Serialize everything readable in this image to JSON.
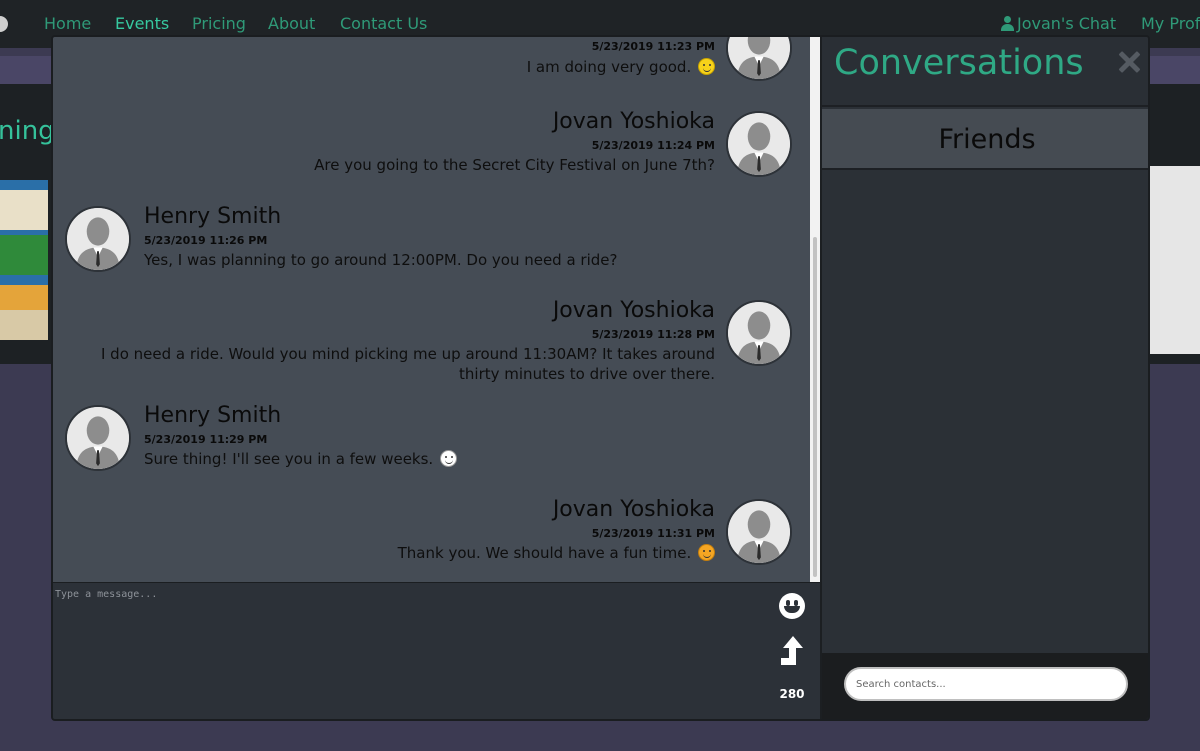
{
  "nav": {
    "items": [
      {
        "label": "Home",
        "active": false
      },
      {
        "label": "Events",
        "active": true
      },
      {
        "label": "Pricing",
        "active": false
      },
      {
        "label": "About",
        "active": false
      },
      {
        "label": "Contact Us",
        "active": false
      }
    ],
    "chat_link": "Jovan's Chat",
    "profile_link": "My Prof"
  },
  "hero": {
    "title_fragment": "ning"
  },
  "chat": {
    "messages": [
      {
        "sender": "",
        "timestamp": "5/23/2019 11:23 PM",
        "text": "I am doing very good.",
        "emoji": "slightly-smiling-face",
        "side": "right"
      },
      {
        "sender": "Jovan Yoshioka",
        "timestamp": "5/23/2019 11:24 PM",
        "text": "Are you going to the Secret City Festival on June 7th?",
        "side": "right"
      },
      {
        "sender": "Henry Smith",
        "timestamp": "5/23/2019 11:26 PM",
        "text": "Yes, I was planning to go around 12:00PM. Do you need a ride?",
        "side": "left"
      },
      {
        "sender": "Jovan Yoshioka",
        "timestamp": "5/23/2019 11:28 PM",
        "text_line1": "I do need a ride. Would you mind picking me up around 11:30AM? It takes around",
        "text_line2": "thirty minutes to drive over there.",
        "side": "right"
      },
      {
        "sender": "Henry Smith",
        "timestamp": "5/23/2019 11:29 PM",
        "text": "Sure thing! I'll see you in a few weeks.",
        "emoji": "smiling-face",
        "side": "left"
      },
      {
        "sender": "Jovan Yoshioka",
        "timestamp": "5/23/2019 11:31 PM",
        "text": "Thank you. We should have a fun time.",
        "emoji": "smiling-face-with-smiling-eyes",
        "side": "right"
      }
    ],
    "input_placeholder": "Type a message...",
    "char_count": "280",
    "icons": {
      "emoji_button": "smiley-icon",
      "send_button": "send-arrow-icon",
      "avatar": "user-silhouette-icon"
    }
  },
  "sidebar": {
    "title": "Conversations",
    "tab_label": "Friends",
    "search_placeholder": "Search contacts..."
  },
  "colors": {
    "accent": "#2fa985",
    "nav_link": "#2f9a78",
    "chat_bg": "#454c55",
    "panel_bg": "#2b3036"
  }
}
